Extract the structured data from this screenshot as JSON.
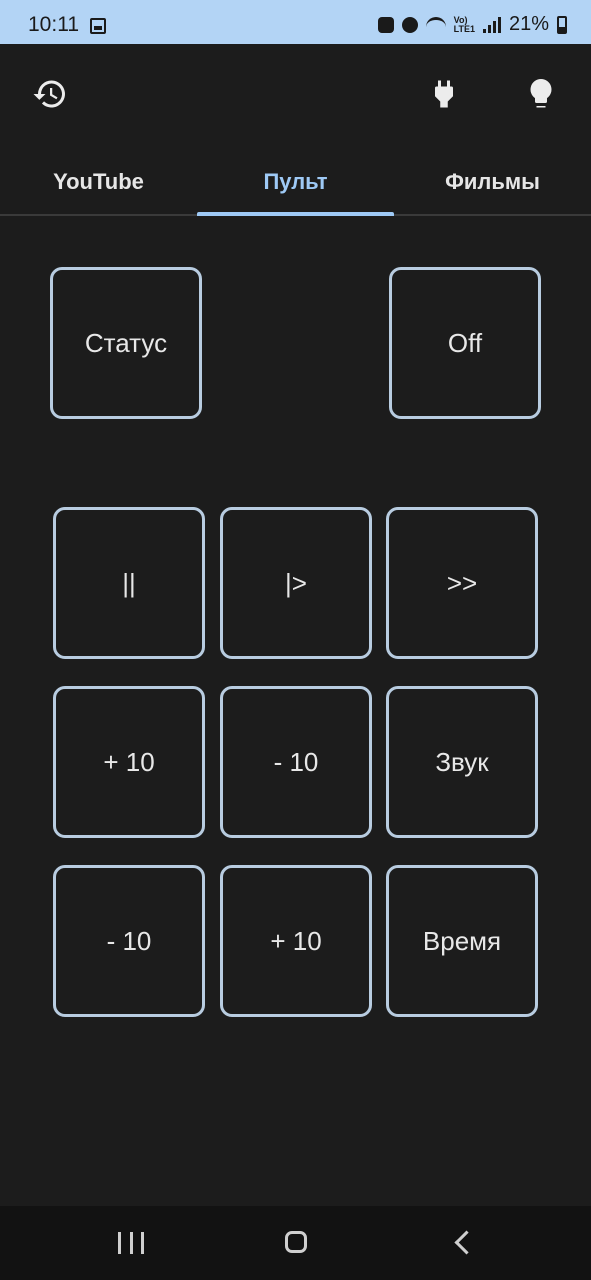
{
  "status_bar": {
    "time": "10:11",
    "lte_label": "Vo)\nLTE1",
    "battery": "21%"
  },
  "toolbar": {
    "history_icon": "history-icon",
    "plug_icon": "plug-icon",
    "bulb_icon": "lightbulb-icon"
  },
  "tabs": [
    {
      "label": "YouTube",
      "active": false
    },
    {
      "label": "Пульт",
      "active": true
    },
    {
      "label": "Фильмы",
      "active": false
    }
  ],
  "top_buttons": {
    "status": "Статус",
    "off": "Off"
  },
  "grid": {
    "row1": [
      "||",
      "|>",
      ">>"
    ],
    "row2": [
      "+ 10",
      "- 10",
      "Звук"
    ],
    "row3": [
      "- 10",
      "+ 10",
      "Время"
    ]
  },
  "colors": {
    "background": "#1c1c1c",
    "status_bar": "#b3d4f5",
    "accent": "#9ec9f5",
    "button_border": "#b8cce0"
  }
}
